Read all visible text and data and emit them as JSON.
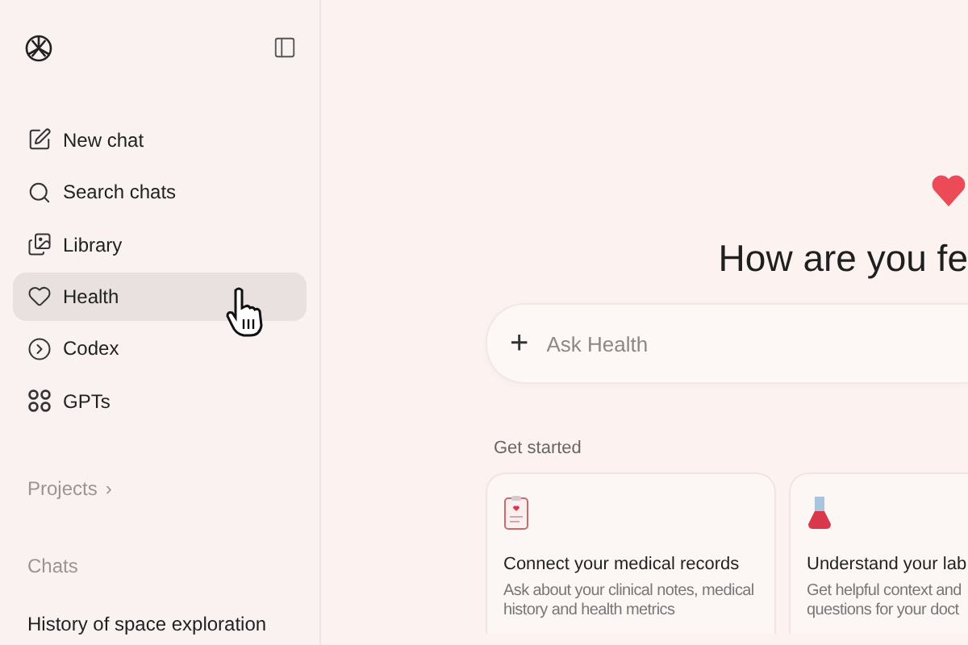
{
  "sidebar": {
    "nav_items": [
      {
        "label": "New chat",
        "selected": false
      },
      {
        "label": "Search chats",
        "selected": false
      },
      {
        "label": "Library",
        "selected": false
      },
      {
        "label": "Health",
        "selected": true
      },
      {
        "label": "Codex",
        "selected": false
      },
      {
        "label": "GPTs",
        "selected": false
      }
    ],
    "projects": {
      "label": "Projects",
      "chevron": "›"
    },
    "chats_heading": "Chats",
    "chats": [
      "History of space exploration"
    ]
  },
  "main": {
    "heading": "How are you fe",
    "composer": {
      "plus": "+",
      "placeholder": "Ask Health"
    },
    "get_started": "Get started",
    "cards": [
      {
        "title": "Connect your medical records",
        "description": "Ask about your clinical notes, medical history and health metrics"
      },
      {
        "title": "Understand your lab",
        "description": "Get helpful context and questions for your doct"
      }
    ]
  }
}
